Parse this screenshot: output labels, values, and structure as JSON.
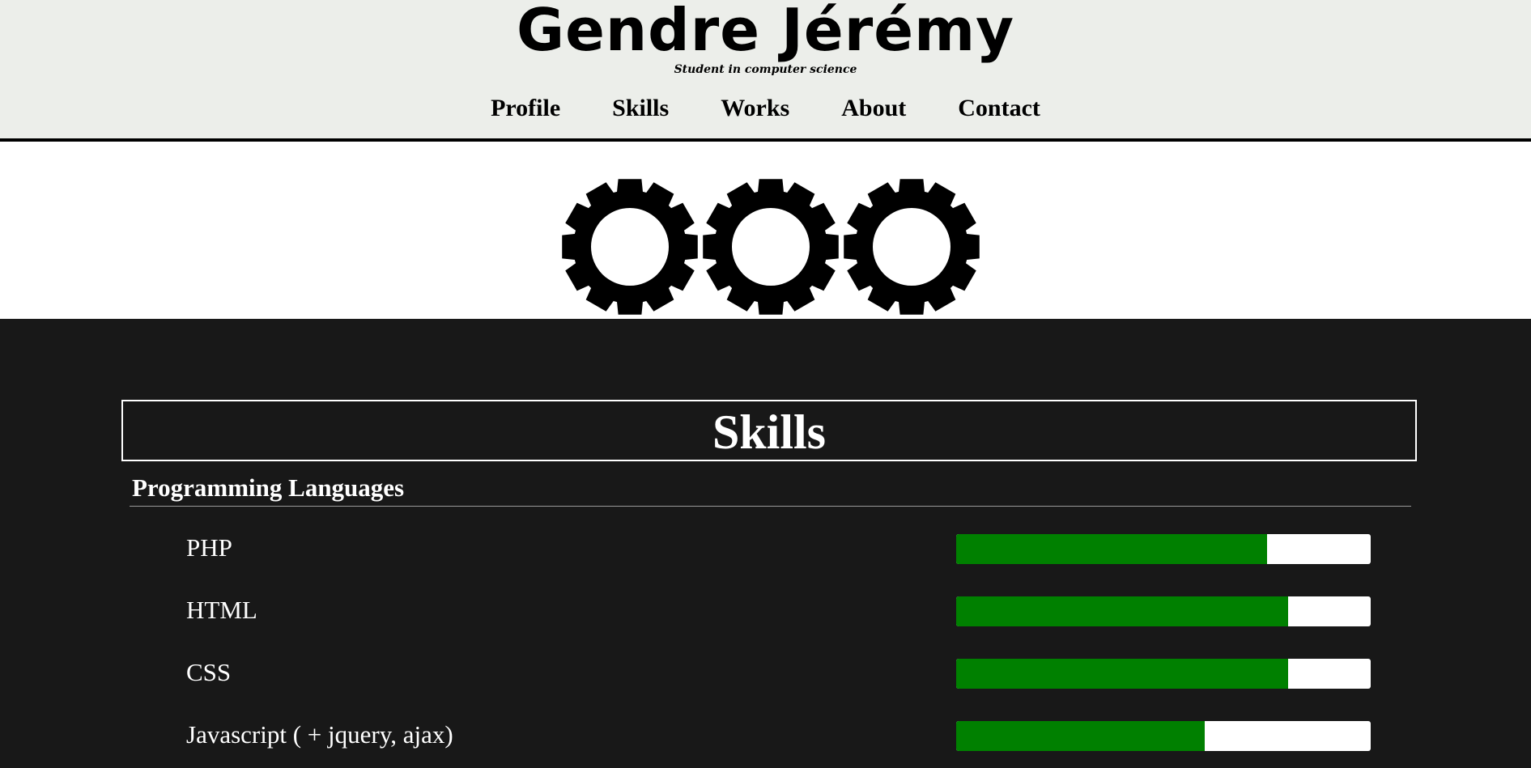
{
  "header": {
    "title": "Gendre Jérémy",
    "subtitle": "Student in computer science",
    "nav": [
      {
        "label": "Profile"
      },
      {
        "label": "Skills"
      },
      {
        "label": "Works"
      },
      {
        "label": "About"
      },
      {
        "label": "Contact"
      }
    ]
  },
  "banner": {
    "icons": [
      "gear-icon",
      "gear-icon",
      "gear-icon"
    ]
  },
  "skills": {
    "title": "Skills",
    "categories": [
      {
        "title": "Programming Languages",
        "items": [
          {
            "name": "PHP",
            "level": 0.75
          },
          {
            "name": "HTML",
            "level": 0.8
          },
          {
            "name": "CSS",
            "level": 0.8
          },
          {
            "name": "Javascript ( + jquery, ajax)",
            "level": 0.6
          }
        ]
      }
    ]
  },
  "colors": {
    "header_bg": "#eceeea",
    "dark_bg": "#181818",
    "bar_fill": "#008000",
    "bar_track": "#ffffff"
  }
}
